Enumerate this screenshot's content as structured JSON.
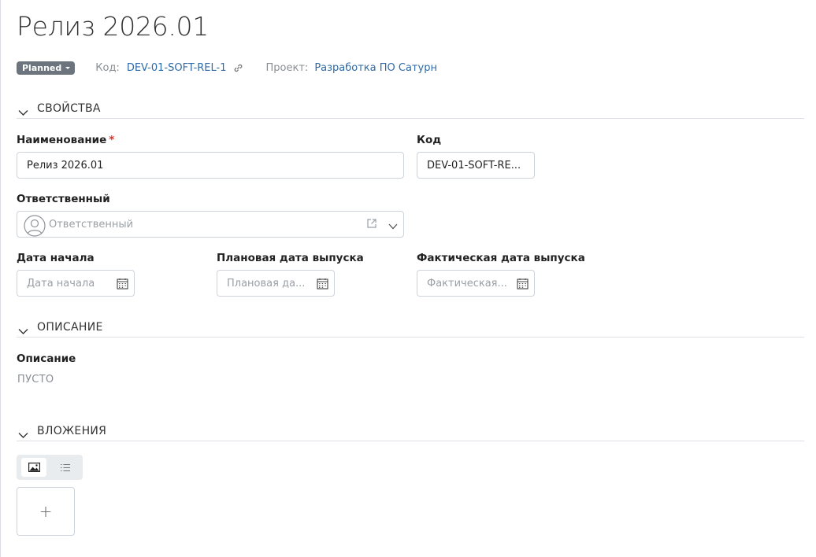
{
  "page": {
    "title": "Релиз 2026.01"
  },
  "header": {
    "status_label": "Planned",
    "code_label": "Код:",
    "code_value": "DEV-01-SOFT-REL-1",
    "project_label": "Проект:",
    "project_value": "Разработка ПО Сатурн"
  },
  "sections": {
    "properties": "СВОЙСТВА",
    "description": "ОПИСАНИЕ",
    "attachments": "ВЛОЖЕНИЯ"
  },
  "fields": {
    "name": {
      "label": "Наименование",
      "required_mark": "*",
      "value": "Релиз 2026.01"
    },
    "code": {
      "label": "Код",
      "value": "DEV-01-SOFT-RE..."
    },
    "owner": {
      "label": "Ответственный",
      "placeholder": "Ответственный"
    },
    "start_date": {
      "label": "Дата начала",
      "placeholder": "Дата начала"
    },
    "planned_date": {
      "label": "Плановая дата выпуска",
      "placeholder": "Плановая да..."
    },
    "actual_date": {
      "label": "Фактическая дата выпуска",
      "placeholder": "Фактическая..."
    }
  },
  "description": {
    "label": "Описание",
    "empty_text": "ПУСТО"
  },
  "attachments": {
    "add_label": "+"
  },
  "icons": {
    "status_caret": "caret-down-icon",
    "code_link": "link-icon",
    "section_toggle": "chevron-down-icon",
    "owner_avatar": "user-avatar-icon",
    "owner_open": "external-link-icon",
    "owner_dropdown": "chevron-down-icon",
    "date_picker": "calendar-icon",
    "view_gallery": "image-icon",
    "view_list": "list-icon"
  },
  "colors": {
    "link": "#2d6aa8",
    "badge": "#6c757d",
    "required": "#d93025",
    "muted": "#8a8f96"
  }
}
